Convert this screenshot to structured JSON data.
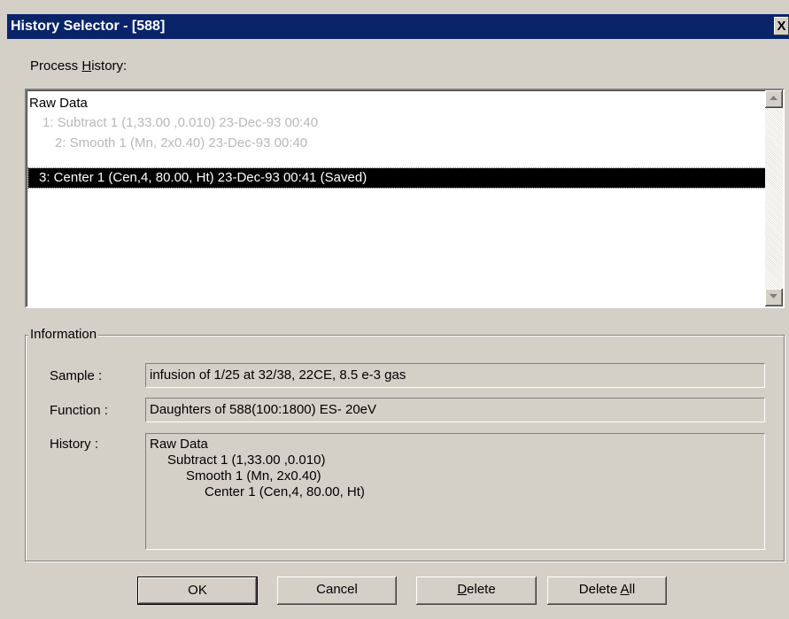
{
  "window": {
    "title": "History Selector - [588]",
    "close_label": "X"
  },
  "process_history": {
    "label_pre": "Process ",
    "label_accel": "H",
    "label_post": "istory:",
    "items": [
      {
        "text": "Raw Data"
      },
      {
        "text": "1: Subtract  1 (1,33.00 ,0.010)  23-Dec-93 00:40"
      },
      {
        "text": "2: Smooth  1 (Mn, 2x0.40)  23-Dec-93 00:40"
      },
      {
        "text": "3: Center  1 (Cen,4, 80.00, Ht)  23-Dec-93 00:41 (Saved)"
      }
    ]
  },
  "information": {
    "legend": "Information",
    "sample_label": "Sample :",
    "sample_value": "infusion of 1/25 at 32/38, 22CE, 8.5 e-3 gas",
    "function_label": "Function :",
    "function_value": "Daughters of 588(100:1800) ES- 20eV",
    "history_label": "History :",
    "history_lines": [
      "Raw Data",
      "Subtract  1 (1,33.00 ,0.010)",
      "Smooth  1 (Mn, 2x0.40)",
      "Center  1 (Cen,4, 80.00, Ht)"
    ]
  },
  "buttons": {
    "ok": "OK",
    "cancel": "Cancel",
    "delete_accel": "D",
    "delete_rest": "elete",
    "delete_all_pre": "Delete ",
    "delete_all_accel": "A",
    "delete_all_rest": "ll"
  }
}
